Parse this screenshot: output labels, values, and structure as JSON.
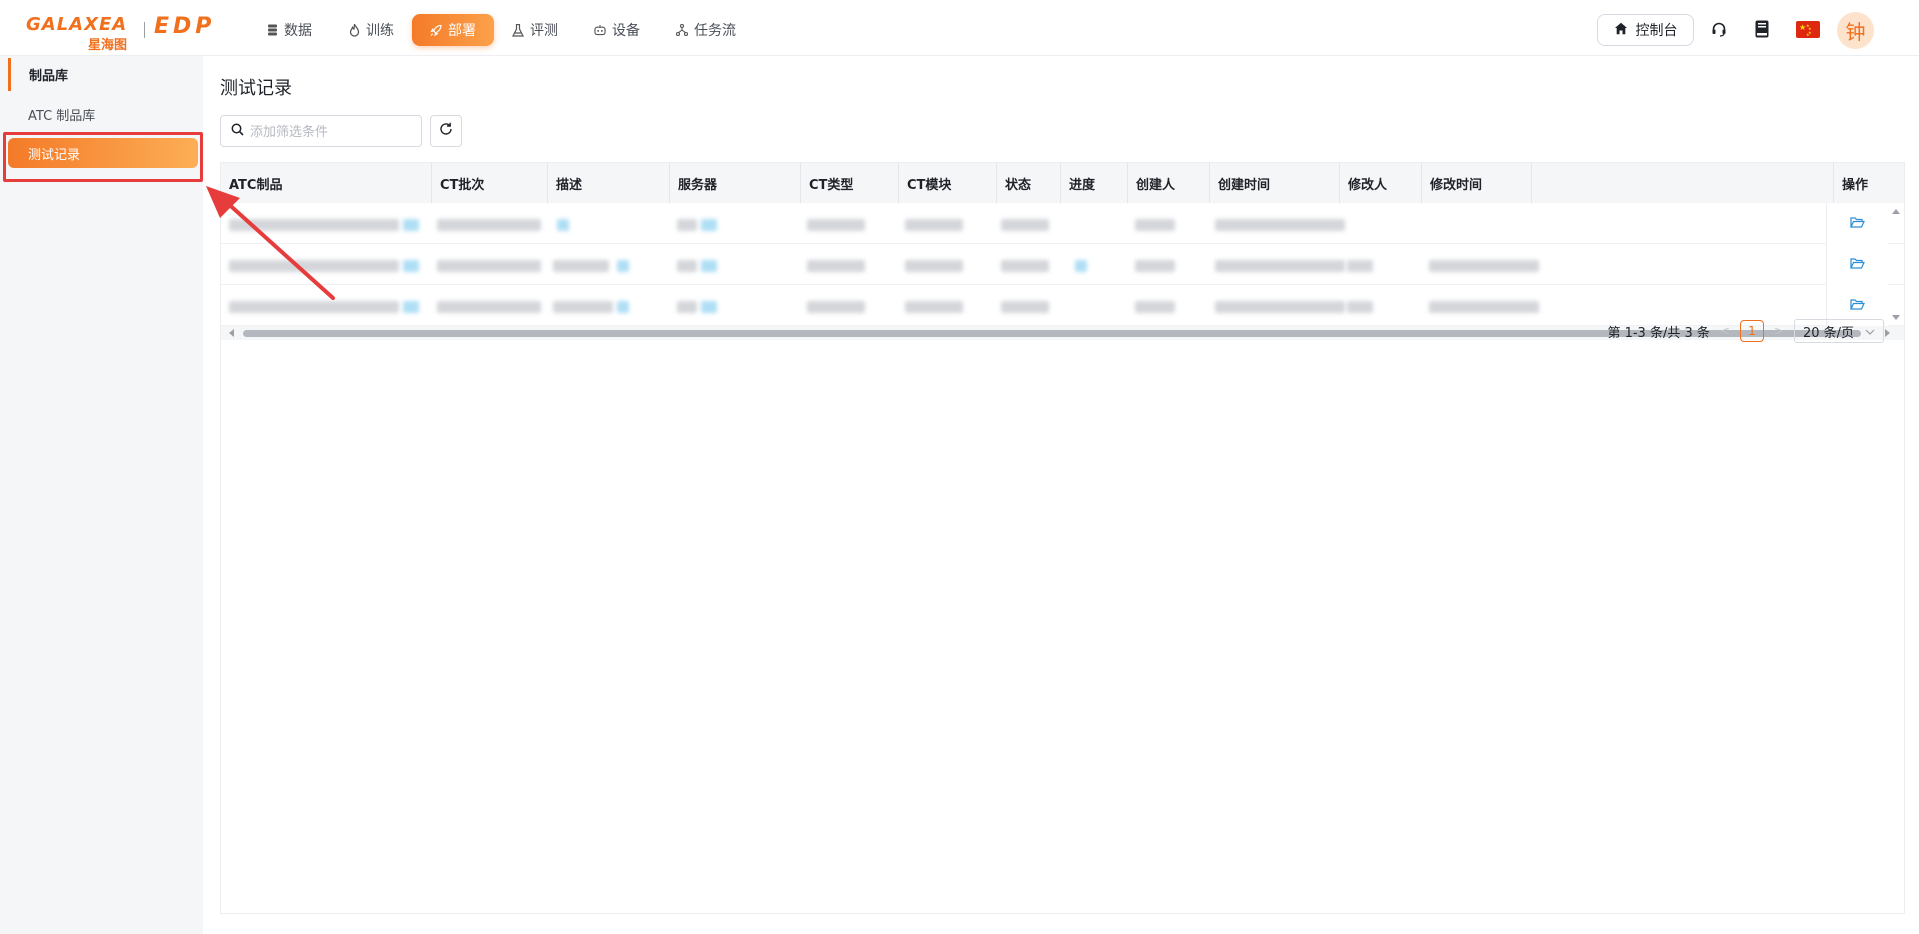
{
  "header": {
    "logo_text": "GALAXEA",
    "logo_sub": "星海图",
    "logo_product": "EDP",
    "nav": [
      {
        "label": "数据",
        "icon": "database-icon",
        "active": false
      },
      {
        "label": "训练",
        "icon": "flame-icon",
        "active": false
      },
      {
        "label": "部署",
        "icon": "rocket-icon",
        "active": true
      },
      {
        "label": "评测",
        "icon": "flask-icon",
        "active": false
      },
      {
        "label": "设备",
        "icon": "robot-icon",
        "active": false
      },
      {
        "label": "任务流",
        "icon": "flow-icon",
        "active": false
      }
    ],
    "console_label": "控制台",
    "avatar_text": "钟"
  },
  "sidebar": {
    "group_label": "制品库",
    "items": [
      {
        "label": "ATC 制品库",
        "active": false
      },
      {
        "label": "测试记录",
        "active": true
      }
    ]
  },
  "main": {
    "page_title": "测试记录",
    "search": {
      "placeholder": "添加筛选条件",
      "value": ""
    },
    "table": {
      "columns": [
        "ATC制品",
        "CT批次",
        "描述",
        "服务器",
        "CT类型",
        "CT模块",
        "状态",
        "进度",
        "创建人",
        "创建时间",
        "修改人",
        "修改时间",
        "操作"
      ],
      "row_count": 3
    },
    "pagination": {
      "summary": "第 1-3 条/共 3 条",
      "current_page": "1",
      "page_size": "20 条/页"
    }
  },
  "colors": {
    "accent": "#f0701e",
    "accent_light": "#fca14a",
    "annotation_red": "#e63c3c"
  }
}
